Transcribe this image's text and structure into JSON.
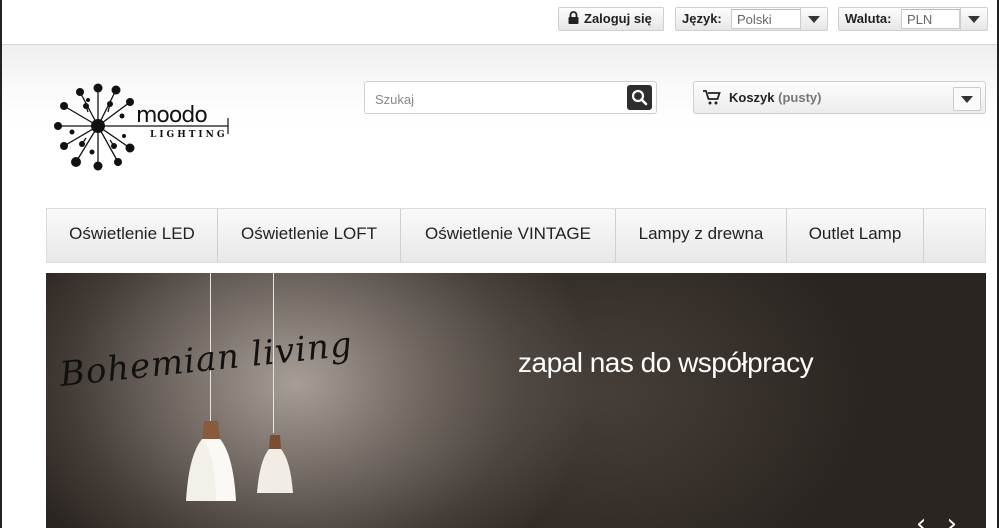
{
  "topbar": {
    "login_label": "Zaloguj się",
    "language_label": "Język:",
    "language_value": "Polski",
    "currency_label": "Waluta:",
    "currency_value": "PLN"
  },
  "header": {
    "logo_text": "moodo",
    "logo_subtext": "LIGHTING",
    "search_placeholder": "Szukaj",
    "cart_label": "Koszyk",
    "cart_status": "(pusty)"
  },
  "nav": {
    "items": [
      {
        "label": "Oświetlenie LED"
      },
      {
        "label": "Oświetlenie LOFT"
      },
      {
        "label": "Oświetlenie VINTAGE"
      },
      {
        "label": "Lampy z drewna"
      },
      {
        "label": "Outlet Lamp"
      }
    ]
  },
  "banner": {
    "handwritten": "Bohemian living",
    "slogan": "zapal nas do współpracy",
    "arrows": "‹ ›"
  },
  "colors": {
    "accent_dark": "#2e2e2e",
    "banner_bg": "#3a322d",
    "text": "#222222"
  },
  "icons": {
    "login": "lock-icon",
    "search": "search-icon",
    "cart": "cart-icon",
    "dropdown": "chevron-down-icon"
  }
}
